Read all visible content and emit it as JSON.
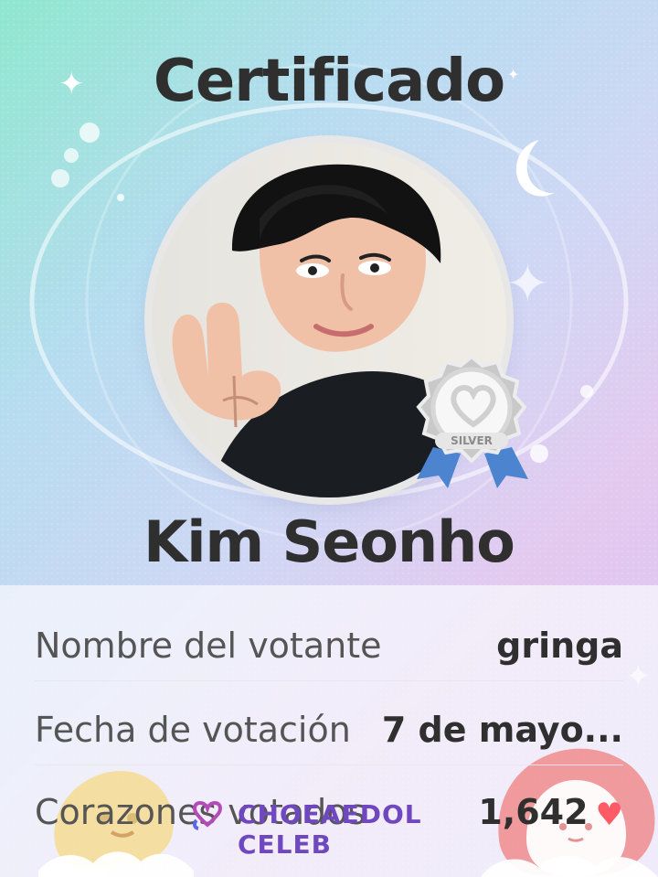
{
  "header": {
    "title": "Certificado"
  },
  "profile": {
    "name": "Kim Seonho",
    "badge_text": "SILVER"
  },
  "details": {
    "rows": [
      {
        "label": "Nombre del votante",
        "value": "gringa"
      },
      {
        "label": "Fecha de votación",
        "value": "7 de mayo..."
      },
      {
        "label": "Corazones votados",
        "value": "1,642"
      }
    ]
  },
  "watermark": {
    "text": "CHOEAEDOL CELEB"
  },
  "colors": {
    "title_text": "#2f2f2f",
    "label_text": "#555555",
    "heart": "#ff5b67",
    "watermark": "#6f47bf"
  },
  "icons": {
    "sparkle": "sparkle-icon",
    "moon": "moon-icon",
    "medal": "silver-medal-icon",
    "heart": "heart-icon",
    "watermark_logo": "choeaedol-logo-icon"
  }
}
